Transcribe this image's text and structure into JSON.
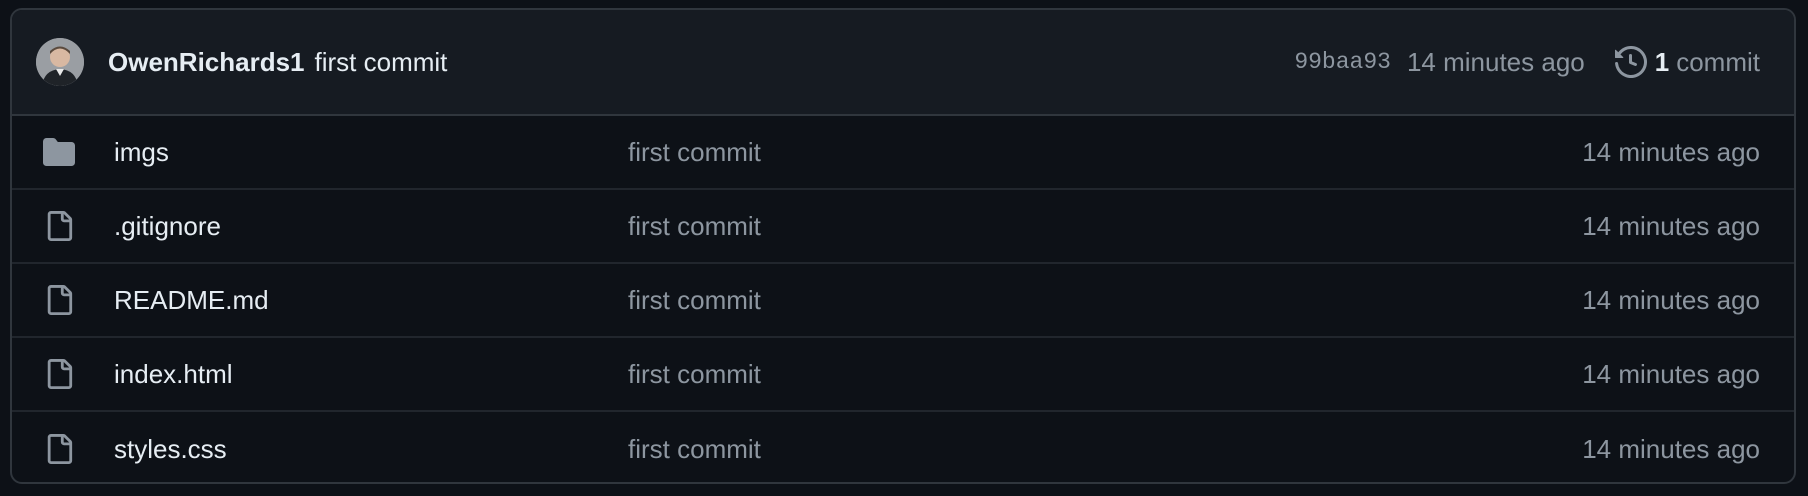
{
  "latest_commit": {
    "author": "OwenRichards1",
    "message": "first commit",
    "sha": "99baa93",
    "time": "14 minutes ago",
    "commit_count": "1",
    "commit_label": "commit"
  },
  "files": [
    {
      "name": "imgs",
      "type": "folder",
      "icon": "folder-icon",
      "commit": "first commit",
      "time": "14 minutes ago"
    },
    {
      "name": ".gitignore",
      "type": "file",
      "icon": "file-icon",
      "commit": "first commit",
      "time": "14 minutes ago"
    },
    {
      "name": "README.md",
      "type": "file",
      "icon": "file-icon",
      "commit": "first commit",
      "time": "14 minutes ago"
    },
    {
      "name": "index.html",
      "type": "file",
      "icon": "file-icon",
      "commit": "first commit",
      "time": "14 minutes ago"
    },
    {
      "name": "styles.css",
      "type": "file",
      "icon": "file-icon",
      "commit": "first commit",
      "time": "14 minutes ago"
    }
  ],
  "colors": {
    "background": "#0d1117",
    "header_background": "#161b22",
    "border": "#30363d",
    "text_primary": "#e6edf3",
    "text_muted": "#8d96a0",
    "icon": "#8d96a0"
  }
}
